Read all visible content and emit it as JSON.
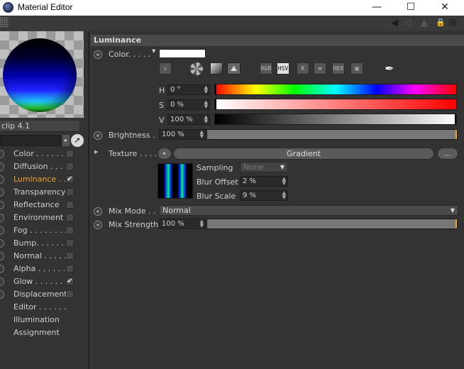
{
  "window": {
    "title": "Material Editor",
    "minimize": "—",
    "maximize": "☐",
    "close": "✕"
  },
  "toolbar": {
    "back_icon": "◀",
    "forward_icon": "◁",
    "up_icon": "▲",
    "lock_icon": "🔒",
    "new_icon": "⊞"
  },
  "left": {
    "clip_name": "clip 4.1",
    "channels": [
      {
        "label": "Color . . . . . . . .",
        "checked": false
      },
      {
        "label": "Diffusion . . . . .",
        "checked": false
      },
      {
        "label": "Luminance . .",
        "checked": true,
        "active": true
      },
      {
        "label": "Transparency",
        "checked": false
      },
      {
        "label": "Reflectance",
        "checked": false
      },
      {
        "label": "Environment",
        "checked": false
      },
      {
        "label": "Fog . . . . . . . . .",
        "checked": false
      },
      {
        "label": "Bump. . . . . . .",
        "checked": false
      },
      {
        "label": "Normal . . . . .",
        "checked": false
      },
      {
        "label": "Alpha . . . . . .",
        "checked": false
      },
      {
        "label": "Glow . . . . . . .",
        "checked": true
      },
      {
        "label": "Displacement",
        "checked": false
      },
      {
        "label": "Editor . . . . . .",
        "checkbox": false
      },
      {
        "label": "Illumination",
        "checkbox": false
      },
      {
        "label": "Assignment",
        "checkbox": false
      }
    ]
  },
  "luminance": {
    "section_title": "Luminance",
    "color_label": "Color. . . . .",
    "color_value": "#ffffff",
    "modes": [
      "RGB",
      "HSV",
      "K",
      "≡",
      "HEX",
      "▦"
    ],
    "selected_mode": "HSV",
    "h_label": "H",
    "h_value": "0 °",
    "s_label": "S",
    "s_value": "0 %",
    "v_label": "V",
    "v_value": "100 %",
    "brightness_label": "Brightness .",
    "brightness_value": "100 %",
    "brightness_fraction": 1.0,
    "texture_label": "Texture . . . .",
    "texture_name": "Gradient",
    "more_button": "...",
    "sampling_label": "Sampling",
    "sampling_value": "None",
    "blur_offset_label": "Blur Offset",
    "blur_offset_value": "2 %",
    "blur_scale_label": "Blur Scale",
    "blur_scale_value": "9 %",
    "mix_mode_label": "Mix Mode . .",
    "mix_mode_value": "Normal",
    "mix_strength_label": "Mix Strength",
    "mix_strength_value": "100 %",
    "mix_strength_fraction": 1.0
  },
  "colors": {
    "accent": "#f0a030",
    "panel": "#333333",
    "header": "#4a4a4a"
  }
}
